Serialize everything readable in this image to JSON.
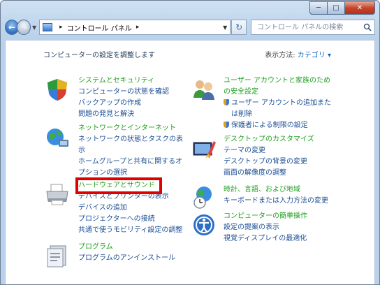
{
  "window": {
    "buttons": {
      "minimize": "─",
      "maximize": "□",
      "close": "✕"
    }
  },
  "nav": {
    "back": "←",
    "forward": "→",
    "address": {
      "separator": "▸",
      "location": "コントロール パネル",
      "trailing": "▸"
    },
    "refresh": "↻",
    "search_placeholder": "コントロール パネルの検索"
  },
  "header": {
    "title": "コンピューターの設定を調整します"
  },
  "view": {
    "label": "表示方法:",
    "value": "カテゴリ",
    "arrow": "▾"
  },
  "categories_left": [
    {
      "id": "system",
      "title": "システムとセキュリティ",
      "items": [
        "コンピューターの状態を確認",
        "バックアップの作成",
        "問題の発見と解決"
      ]
    },
    {
      "id": "network",
      "title": "ネットワークとインターネット",
      "items": [
        "ネットワークの状態とタスクの表",
        "示",
        "ホームグループと共有に関するオ",
        "プションの選択"
      ]
    },
    {
      "id": "hardware",
      "title": "ハードウェアとサウンド",
      "items": [
        "デバイスとプリンターの表示",
        "デバイスの追加",
        "プロジェクターへの接続",
        "共通で使うモビリティ設定の調整"
      ]
    },
    {
      "id": "programs",
      "title": "プログラム",
      "items": [
        "プログラムのアンインストール"
      ]
    }
  ],
  "categories_right": [
    {
      "id": "users",
      "title": "ユーザー アカウントと家族のため",
      "title2": "の安全設定",
      "items": [
        {
          "text": "ユーザー アカウントの追加また",
          "shield": true
        },
        {
          "text": "は削除",
          "shield": false
        },
        {
          "text": "保護者による制限の設定",
          "shield": true
        }
      ]
    },
    {
      "id": "appearance",
      "title": "デスクトップのカスタマイズ",
      "items": [
        "テーマの変更",
        "デスクトップの背景の変更",
        "画面の解像度の調整"
      ]
    },
    {
      "id": "clock",
      "title": "時計、言語、および地域",
      "items": [
        "キーボードまたは入力方法の変更"
      ]
    },
    {
      "id": "ease",
      "title": "コンピューターの簡単操作",
      "items": [
        "設定の提案の表示",
        "視覚ディスプレイの最適化"
      ]
    }
  ],
  "colors": {
    "title": "#20a020",
    "link": "#1c4f94",
    "highlight": "#e00000"
  }
}
